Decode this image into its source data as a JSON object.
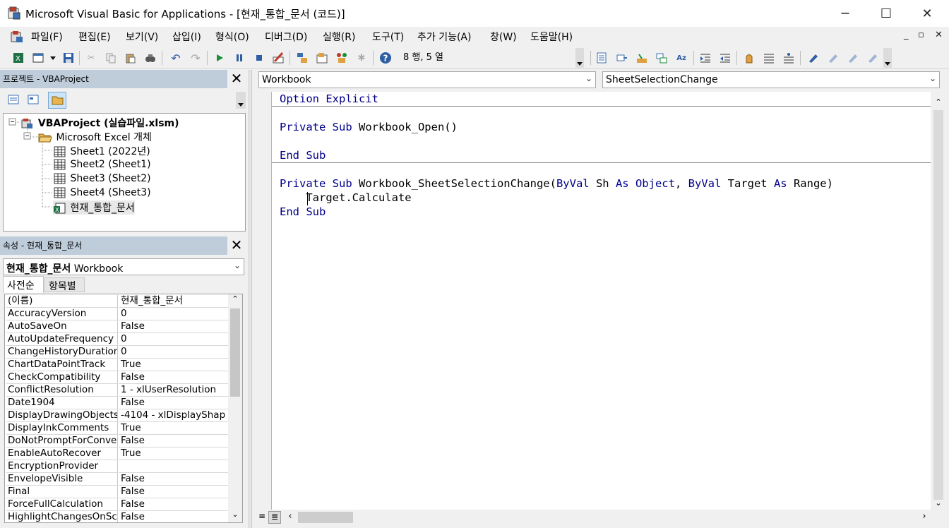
{
  "window": {
    "title": "Microsoft Visual Basic for Applications - [현재_통합_문서 (코드)]",
    "minimize": "─",
    "maximize": "☐",
    "close": "✕"
  },
  "menu": {
    "items": [
      "파일(F)",
      "편집(E)",
      "보기(V)",
      "삽입(I)",
      "형식(O)",
      "디버그(D)",
      "실행(R)",
      "도구(T)",
      "추가 기능(A)",
      "창(W)",
      "도움말(H)"
    ],
    "mdi_min": "_",
    "mdi_restore": "▫",
    "mdi_close": "✕"
  },
  "toolbar": {
    "position": "8 행, 5 열",
    "help": "?"
  },
  "project": {
    "header": "프로젝트 - VBAProject",
    "close": "✕",
    "root": "VBAProject (실습파일.xlsm)",
    "folder": "Microsoft Excel 개체",
    "sheets": [
      "Sheet1 (2022년)",
      "Sheet2 (Sheet1)",
      "Sheet3 (Sheet2)",
      "Sheet4 (Sheet3)"
    ],
    "workbook": "현재_통합_문서"
  },
  "properties": {
    "header": "속성 - 현재_통합_문서",
    "close": "✕",
    "object_name": "현재_통합_문서",
    "object_type": "Workbook",
    "tabs": [
      "사전순",
      "항목별"
    ],
    "rows": [
      {
        "name": "(이름)",
        "value": "현재_통합_문서"
      },
      {
        "name": "AccuracyVersion",
        "value": "0"
      },
      {
        "name": "AutoSaveOn",
        "value": "False"
      },
      {
        "name": "AutoUpdateFrequency",
        "value": "0"
      },
      {
        "name": "ChangeHistoryDuration",
        "value": "0"
      },
      {
        "name": "ChartDataPointTrack",
        "value": "True"
      },
      {
        "name": "CheckCompatibility",
        "value": "False"
      },
      {
        "name": "ConflictResolution",
        "value": "1 - xlUserResolution"
      },
      {
        "name": "Date1904",
        "value": "False"
      },
      {
        "name": "DisplayDrawingObjects",
        "value": "-4104 - xlDisplayShap"
      },
      {
        "name": "DisplayInkComments",
        "value": "True"
      },
      {
        "name": "DoNotPromptForConvert",
        "value": "False"
      },
      {
        "name": "EnableAutoRecover",
        "value": "True"
      },
      {
        "name": "EncryptionProvider",
        "value": ""
      },
      {
        "name": "EnvelopeVisible",
        "value": "False"
      },
      {
        "name": "Final",
        "value": "False"
      },
      {
        "name": "ForceFullCalculation",
        "value": "False"
      },
      {
        "name": "HighlightChangesOnScre",
        "value": "False"
      }
    ]
  },
  "code": {
    "object_combo": "Workbook",
    "procedure_combo": "SheetSelectionChange",
    "lines": {
      "l1_kw": "Option Explicit",
      "l3_kw": "Private Sub",
      "l3_rest": " Workbook_Open()",
      "l5_kw": "End Sub",
      "l7_kw1": "Private Sub",
      "l7_p1": " Workbook_SheetSelectionChange(",
      "l7_kw2": "ByVal",
      "l7_p2": " Sh ",
      "l7_kw3": "As",
      "l7_p3": " ",
      "l7_kw4": "Object",
      "l7_p4": ", ",
      "l7_kw5": "ByVal",
      "l7_p5": " Target ",
      "l7_kw6": "As",
      "l7_p6": " Range)",
      "l8": "    Target.Calculate",
      "l9_kw": "End Sub"
    }
  },
  "colors": {
    "keyword": "#00008b",
    "panel_header": "#bfcddb"
  }
}
